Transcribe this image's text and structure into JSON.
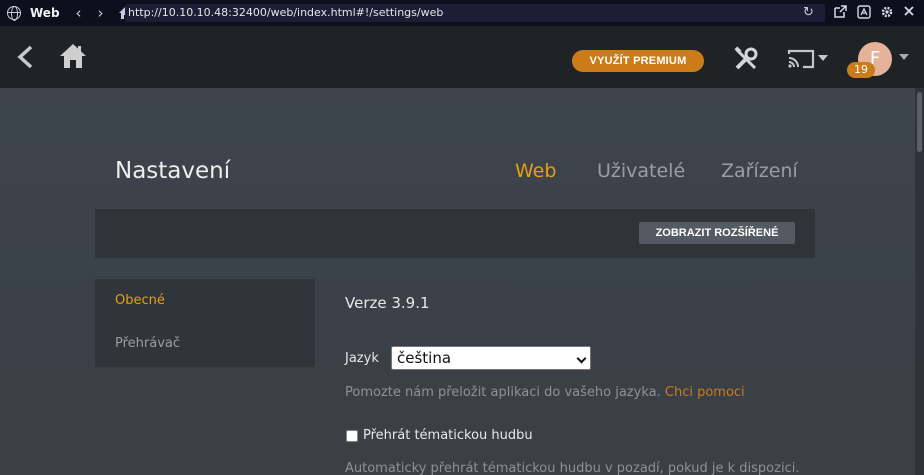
{
  "browser": {
    "tab_title": "Web",
    "back_glyph": "‹",
    "forward_glyph": "›",
    "url": "http://10.10.10.48:32400/web/index.html#!/settings/web",
    "reload_glyph": "↻",
    "icons": [
      "open-external-icon",
      "translate-icon",
      "gear-icon",
      "extension-icon",
      "close-icon"
    ]
  },
  "header": {
    "premium_label": "VYUŽÍT PREMIUM",
    "avatar_initial": "F",
    "badge_count": "19",
    "accent": "#cc7b19"
  },
  "settings": {
    "title": "Nastavení",
    "tabs": [
      {
        "label": "Web",
        "active": true
      },
      {
        "label": "Uživatelé",
        "active": false
      },
      {
        "label": "Zařízení",
        "active": false
      }
    ],
    "show_advanced_label": "ZOBRAZIT ROZŠÍŘENÉ",
    "sidebar": [
      {
        "label": "Obecné",
        "active": true
      },
      {
        "label": "Přehrávač",
        "active": false
      }
    ],
    "version": "Verze 3.9.1",
    "language_label": "Jazyk",
    "language_value": "čeština",
    "help_text": "Pomozte nám přeložit aplikaci do vašeho jazyka.",
    "help_link": "Chci pomoci",
    "theme_music_label": "Přehrát tématickou hudbu",
    "theme_music_help": "Automaticky přehrát tématickou hudbu v pozadí, pokud je k dispozici.",
    "active_color": "#e5a00d"
  }
}
